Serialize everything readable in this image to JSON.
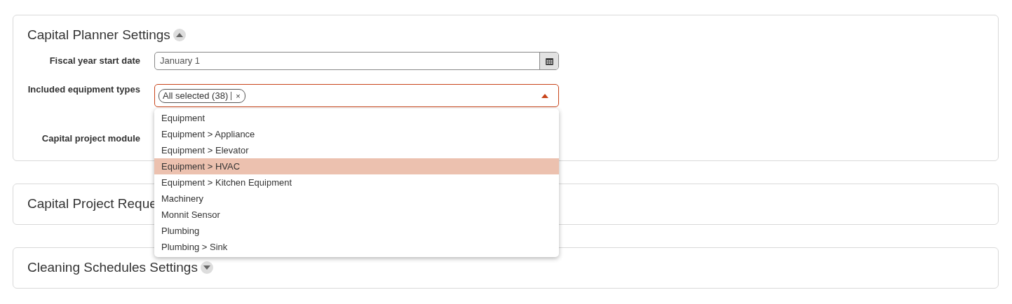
{
  "sections": [
    {
      "title": "Capital Planner Settings",
      "expanded": true,
      "fields": [
        {
          "kind": "date",
          "label": "Fiscal year start date",
          "value": "January 1"
        },
        {
          "kind": "multiselect",
          "label": "Included equipment types",
          "tag": "All selected (38)",
          "remove": "×",
          "open": true,
          "options": [
            {
              "label": "Equipment",
              "selected": false
            },
            {
              "label": "Equipment > Appliance",
              "selected": false
            },
            {
              "label": "Equipment > Elevator",
              "selected": false
            },
            {
              "label": "Equipment > HVAC",
              "selected": true
            },
            {
              "label": "Equipment > Kitchen Equipment",
              "selected": false
            },
            {
              "label": "Machinery",
              "selected": false
            },
            {
              "label": "Monnit Sensor",
              "selected": false
            },
            {
              "label": "Plumbing",
              "selected": false
            },
            {
              "label": "Plumbing > Sink",
              "selected": false
            }
          ]
        },
        {
          "kind": "hidden",
          "label": "Capital project module"
        }
      ]
    },
    {
      "title": "Capital Project Reque"
    },
    {
      "title": "Cleaning Schedules Settings",
      "expanded": false
    }
  ]
}
